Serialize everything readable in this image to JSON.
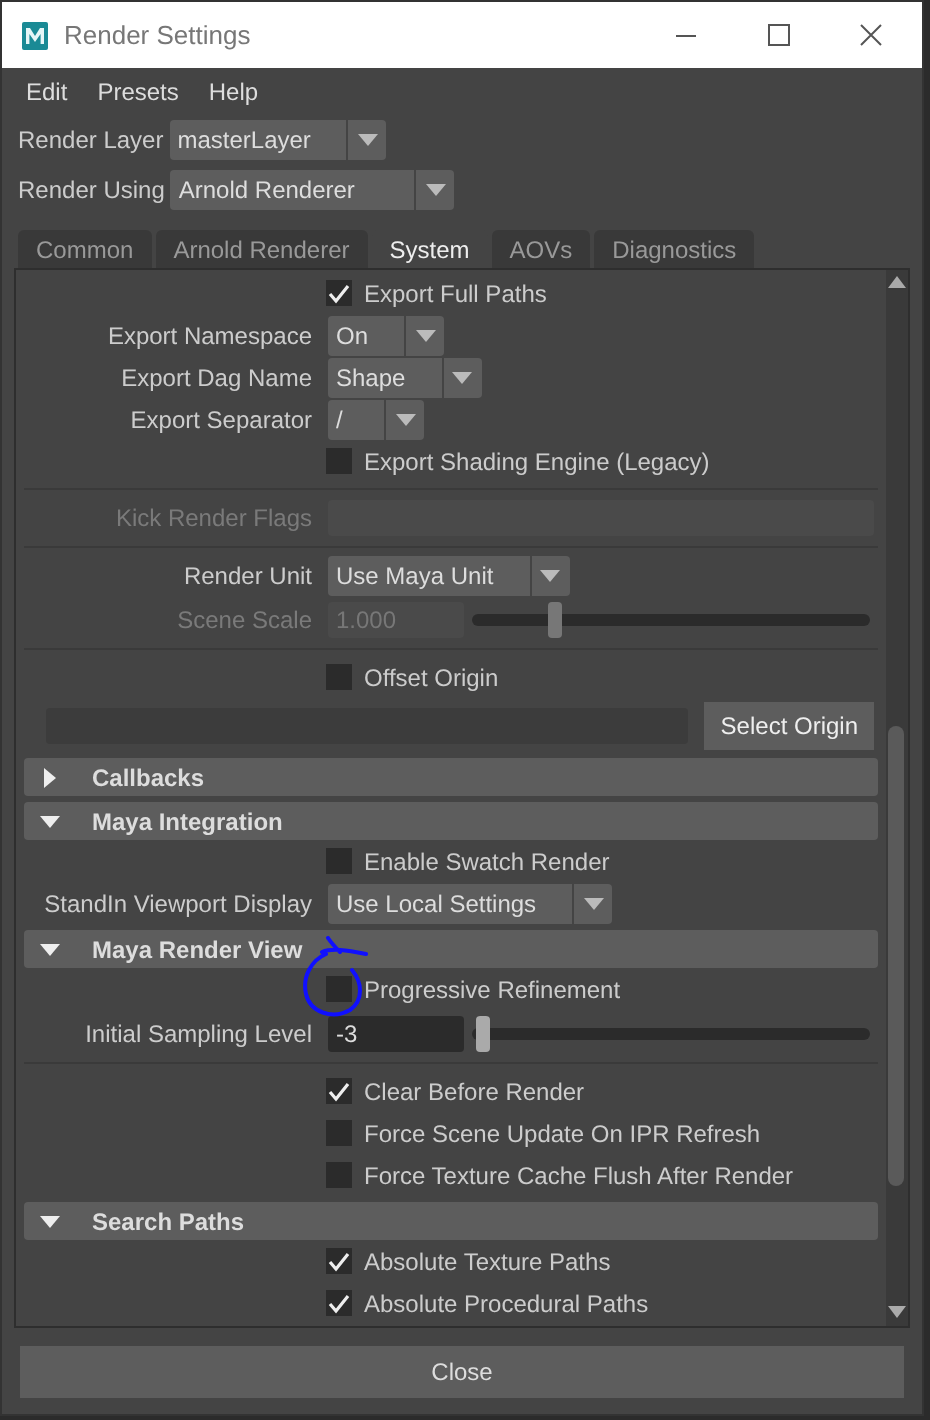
{
  "window": {
    "title": "Render Settings"
  },
  "menu": [
    "Edit",
    "Presets",
    "Help"
  ],
  "render_layer": {
    "label": "Render Layer",
    "value": "masterLayer"
  },
  "render_using": {
    "label": "Render Using",
    "value": "Arnold Renderer"
  },
  "tabs": [
    {
      "label": "Common",
      "selected": false
    },
    {
      "label": "Arnold Renderer",
      "selected": false
    },
    {
      "label": "System",
      "selected": true
    },
    {
      "label": "AOVs",
      "selected": false
    },
    {
      "label": "Diagnostics",
      "selected": false
    }
  ],
  "rows": [
    {
      "kind": "checkbox",
      "label": "Export Full Paths",
      "checked": true
    },
    {
      "kind": "dropdown",
      "label": "Export Namespace",
      "value": "On"
    },
    {
      "kind": "dropdown",
      "label": "Export Dag Name",
      "value": "Shape"
    },
    {
      "kind": "dropdown",
      "label": "Export Separator",
      "value": "/"
    },
    {
      "kind": "checkbox",
      "label": "Export Shading Engine (Legacy)",
      "checked": false,
      "divider_below": true
    },
    {
      "kind": "text_field",
      "label": "Kick Render Flags",
      "disabled": true,
      "divider_below": true
    },
    {
      "kind": "dropdown",
      "label": "Render Unit",
      "value": "Use Maya Unit"
    },
    {
      "kind": "slider",
      "label": "Scene Scale",
      "value": "1.000",
      "level": 0.2,
      "disabled": true,
      "divider_below": true
    },
    {
      "kind": "checkbox",
      "label": "Offset Origin",
      "checked": false
    },
    {
      "kind": "origin",
      "button": "Select Origin"
    },
    {
      "kind": "section",
      "title": "Callbacks",
      "expanded": false
    },
    {
      "kind": "section",
      "title": "Maya Integration",
      "expanded": true
    },
    {
      "kind": "checkbox",
      "label": "Enable Swatch Render",
      "checked": false
    },
    {
      "kind": "dropdown",
      "label": "StandIn Viewport Display",
      "value": "Use Local Settings"
    },
    {
      "kind": "section",
      "title": "Maya Render View",
      "expanded": true
    },
    {
      "kind": "checkbox",
      "label": "Progressive Refinement",
      "checked": false,
      "circled": true
    },
    {
      "kind": "slider",
      "label": "Initial Sampling Level",
      "value": "-3",
      "level": 0.01,
      "disabled": false,
      "divider_below": true
    },
    {
      "kind": "checkbox",
      "label": "Clear Before Render",
      "checked": true
    },
    {
      "kind": "checkbox",
      "label": "Force Scene Update On IPR Refresh",
      "checked": false
    },
    {
      "kind": "checkbox",
      "label": "Force Texture Cache Flush After Render",
      "checked": false
    },
    {
      "kind": "section",
      "title": "Search Paths",
      "expanded": true
    },
    {
      "kind": "checkbox",
      "label": "Absolute Texture Paths",
      "checked": true
    },
    {
      "kind": "checkbox",
      "label": "Absolute Procedural Paths",
      "checked": true
    }
  ],
  "close_button": "Close"
}
